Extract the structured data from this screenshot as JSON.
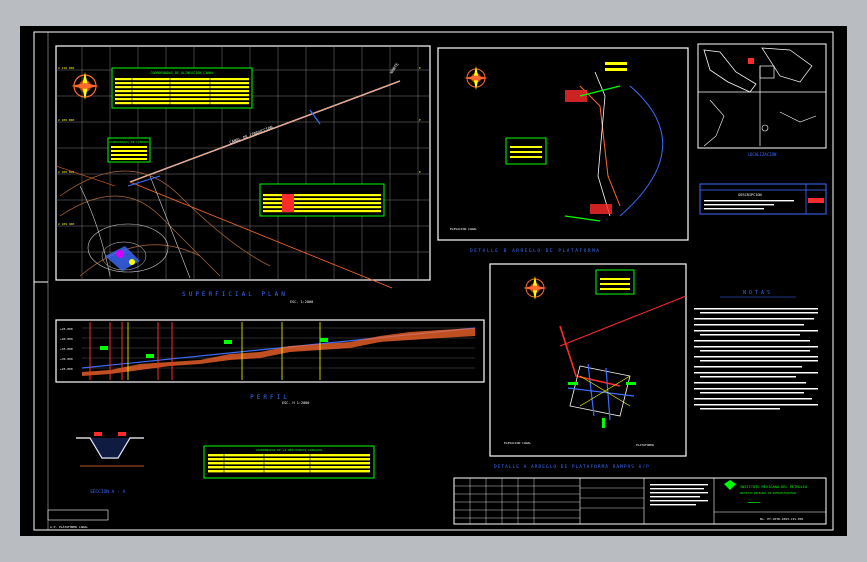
{
  "app": {
    "title": "",
    "accent": "#00ff00"
  },
  "sheet": {
    "plan_title": "SUPERFICIAL  PLAN",
    "plan_scale": "ESC. 1:2000",
    "profile_title": "PERFIL",
    "profile_scale": "ESC. H 1:2000",
    "section_title": "SECCION  A - A",
    "detail_a_title": "DETALLE  B  ARREGLO DE PLATAFORMA",
    "detail_b_title": "DETALLE  A  ARREGLO DE PLATAFORMA RAMPAS A/P",
    "location_title": "LOCALIZACION",
    "notes_title": "NOTAS",
    "tables": {
      "canal_table_title": "COORDENADAS DE ALINEACION CANAL",
      "small_table_title": "COORDENADAS DE LINDERO",
      "profile_table_title": "COORDENADAS DE LA RED PUNTOS CARGADOS",
      "detail_table_title": "ESTACION DE CANAL Y PLATAFORMA",
      "desc_header": "DESCRIPCION"
    },
    "title_block": {
      "institution": "INSTITUTO MEXICANO DEL PETROLEO",
      "subtitle": "PROYECTO INTEGRAL DE INFRAESTRUCTURA",
      "drawing_no": "No. PY-CRTR-1093-CIV-001"
    },
    "status": {
      "coord": "58.8452, 33.6215, 0.0000",
      "model_tab": "MODEL"
    }
  },
  "colors": {
    "frame": "#ffffff",
    "grid": "#8a8a8a",
    "canal": "#ff6a2b",
    "table_border": "#00ff00",
    "table_fill": "#ffff00",
    "accent_blue": "#3c6cff",
    "accent_red": "#ff2a2a",
    "accent_magenta": "#d000ff"
  }
}
